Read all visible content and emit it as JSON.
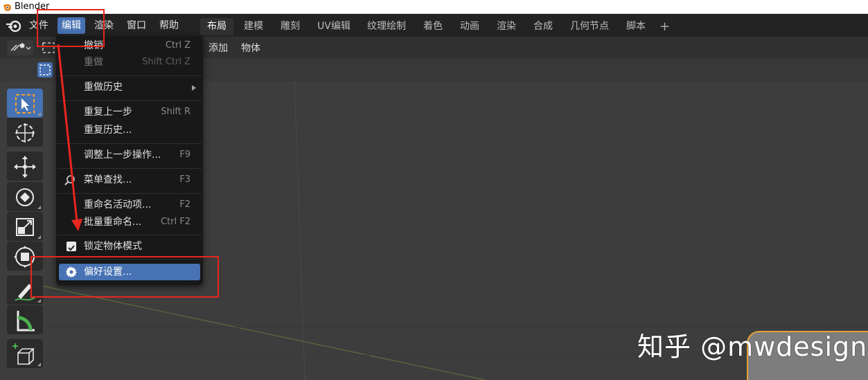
{
  "window": {
    "title": "Blender"
  },
  "topbar": {
    "menus": [
      {
        "label": "文件"
      },
      {
        "label": "编辑"
      },
      {
        "label": "渲染"
      },
      {
        "label": "窗口"
      },
      {
        "label": "帮助"
      }
    ],
    "workspaces": [
      {
        "label": "布局"
      },
      {
        "label": "建模"
      },
      {
        "label": "雕刻"
      },
      {
        "label": "UV编辑"
      },
      {
        "label": "纹理绘制"
      },
      {
        "label": "着色"
      },
      {
        "label": "动画"
      },
      {
        "label": "渲染"
      },
      {
        "label": "合成"
      },
      {
        "label": "几何节点"
      },
      {
        "label": "脚本"
      }
    ],
    "add_workspace": "+"
  },
  "viewport_header": {
    "menus": [
      {
        "label": "添加"
      },
      {
        "label": "物体"
      }
    ]
  },
  "edit_menu": {
    "items": [
      {
        "label": "撤销",
        "shortcut": "Ctrl Z"
      },
      {
        "label": "重做",
        "shortcut": "Shift Ctrl Z"
      },
      {
        "label": "重做历史"
      },
      {
        "label": "重复上一步",
        "shortcut": "Shift R"
      },
      {
        "label": "重复历史..."
      },
      {
        "label": "调整上一步操作...",
        "shortcut": "F9"
      },
      {
        "label": "菜单查找...",
        "shortcut": "F3"
      },
      {
        "label": "重命名活动项...",
        "shortcut": "F2"
      },
      {
        "label": "批量重命名...",
        "shortcut": "Ctrl F2"
      },
      {
        "label": "锁定物体模式",
        "checked": true
      },
      {
        "label": "偏好设置..."
      }
    ]
  },
  "watermark": "知乎 @mwdesign",
  "colors": {
    "accent": "#4772b3",
    "annotation": "#e8261f"
  },
  "icons": [
    "blender-logo-icon",
    "select-box-icon",
    "cursor-icon",
    "move-icon",
    "rotate-icon",
    "scale-icon",
    "transform-icon",
    "annotate-icon",
    "measure-icon",
    "add-cube-icon",
    "search-icon",
    "gear-icon",
    "checkbox-icon",
    "submenu-arrow-icon"
  ]
}
